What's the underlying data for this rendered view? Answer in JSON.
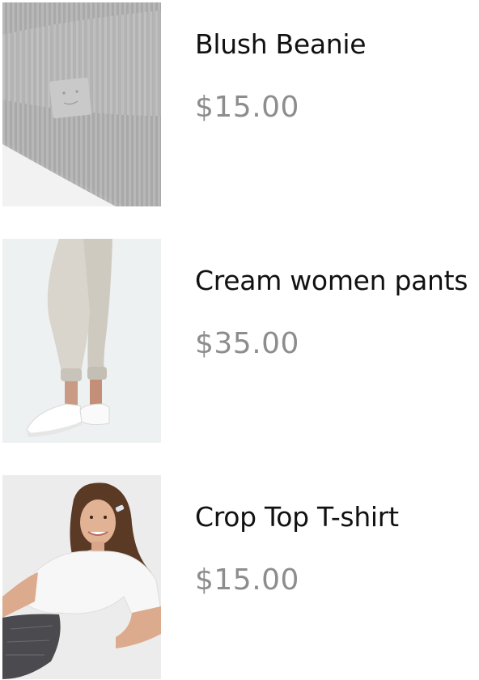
{
  "products": [
    {
      "name": "Blush Beanie",
      "price": "$15.00",
      "image_icon": "beanie-image"
    },
    {
      "name": "Cream women pants",
      "price": "$35.00",
      "image_icon": "pants-image"
    },
    {
      "name": "Crop Top T-shirt",
      "price": "$15.00",
      "image_icon": "tshirt-image"
    }
  ],
  "colors": {
    "name_text": "#111111",
    "price_text": "#8d8d8d",
    "background": "#ffffff"
  }
}
